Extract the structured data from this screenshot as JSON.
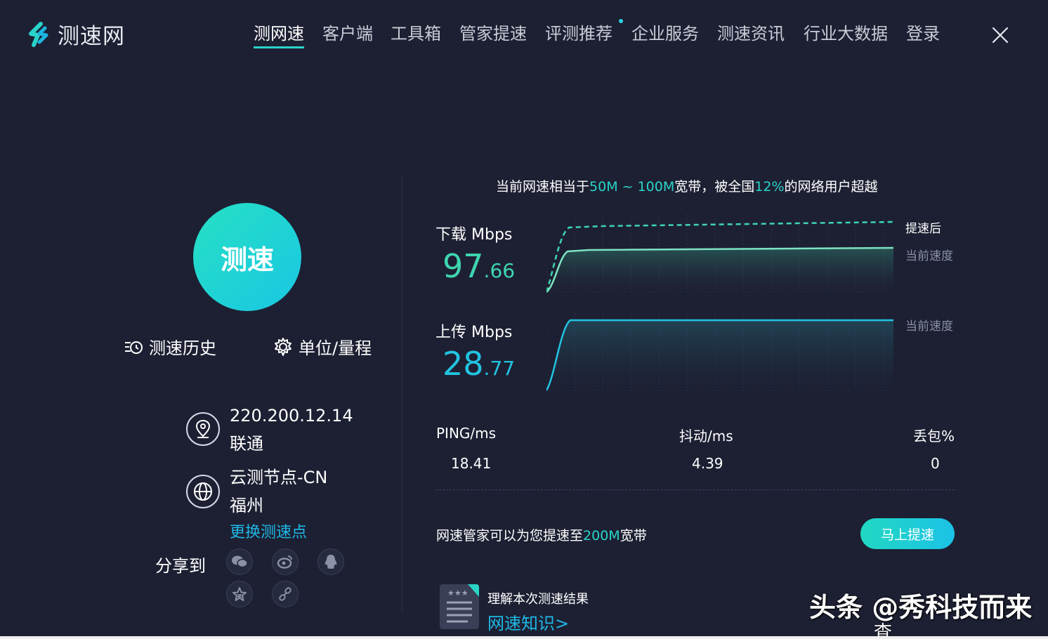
{
  "header": {
    "logo_text": "测速网",
    "nav": [
      {
        "label": "测网速",
        "active": true
      },
      {
        "label": "客户端"
      },
      {
        "label": "工具箱"
      },
      {
        "label": "管家提速"
      },
      {
        "label": "评测推荐"
      },
      {
        "label": "企业服务"
      },
      {
        "label": "测速资讯"
      },
      {
        "label": "行业大数据"
      },
      {
        "label": "登录"
      }
    ],
    "close_icon": "close-icon"
  },
  "left": {
    "speed_button": "测速",
    "history_label": "测速历史",
    "unit_label": "单位/量程",
    "ip": "220.200.12.14",
    "isp": "联通",
    "node": "云测节点-CN",
    "city": "福州",
    "change_node": "更换测速点",
    "share_label": "分享到",
    "share_icons": [
      "wechat-icon",
      "weibo-icon",
      "qq-icon",
      "qzone-icon",
      "link-icon"
    ]
  },
  "summary": {
    "prefix": "当前网速相当于",
    "range": "50M ~ 100M",
    "middle": "宽带，被全国",
    "percent": "12%",
    "suffix": "的网络用户超越"
  },
  "download": {
    "label": "下载 Mbps",
    "int": "97",
    "dec": ".66",
    "legend_after": "提速后",
    "legend_current": "当前速度"
  },
  "upload": {
    "label": "上传 Mbps",
    "int": "28",
    "dec": ".77",
    "legend_current": "当前速度"
  },
  "stats": {
    "ping_label": "PING/ms",
    "ping": "18.41",
    "jitter_label": "抖动/ms",
    "jitter": "4.39",
    "loss_label": "丢包%",
    "loss": "0"
  },
  "promo": {
    "prefix": "网速管家可以为您提速至",
    "value": "200M",
    "suffix": "宽带",
    "button": "马上提速"
  },
  "knowledge": {
    "title": "理解本次测速结果",
    "link": "网速知识>"
  },
  "watermark": {
    "main": "头条 @秀科技而来",
    "sub": "查"
  },
  "colors": {
    "accent": "#2ad5c8",
    "link": "#1fb8e6",
    "background": "#1d2033",
    "download": "#3ed6b0",
    "upload": "#22c3e0"
  }
}
